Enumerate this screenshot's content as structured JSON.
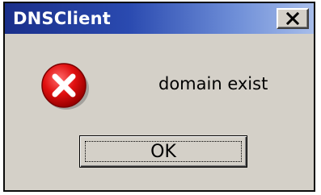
{
  "window": {
    "title": "DNSClient",
    "close_icon": "close-icon"
  },
  "dialog": {
    "icon": "error-icon",
    "message": "domain exist",
    "ok_label": "OK"
  },
  "colors": {
    "titlebar_start": "#1a2f8a",
    "titlebar_end": "#a7bdea",
    "dialog_background": "#d4d0c8",
    "error_red": "#e01010"
  }
}
